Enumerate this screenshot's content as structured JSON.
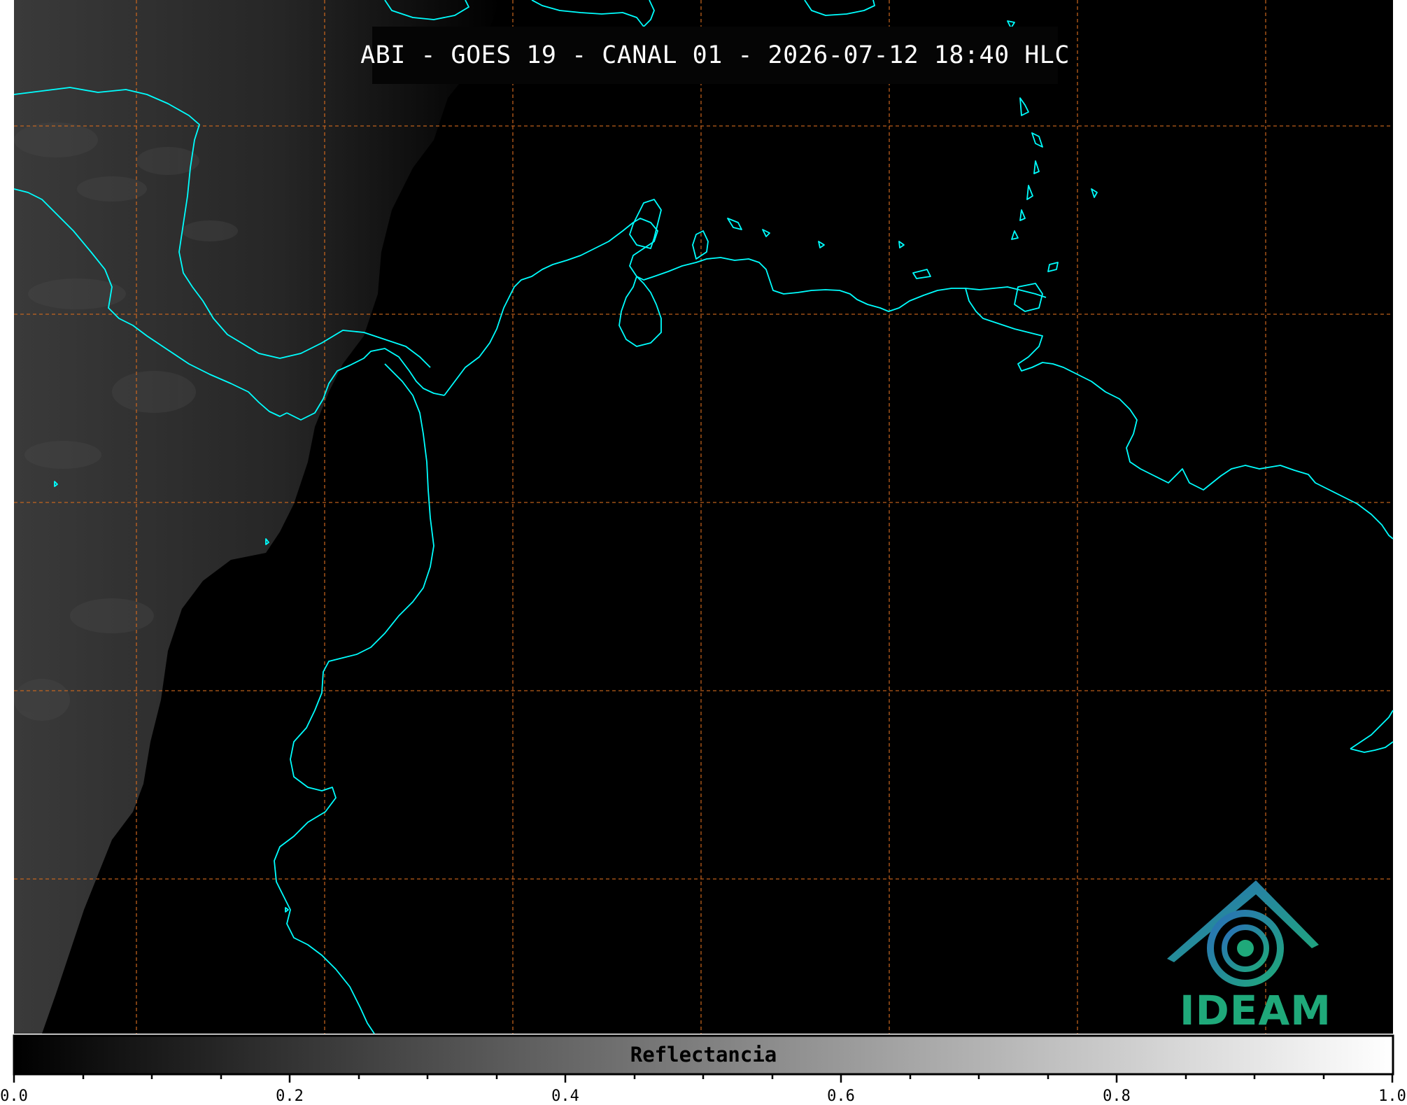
{
  "title": "ABI - GOES 19 - CANAL 01 - 2026-07-12 18:40 HLC",
  "colorbar": {
    "label": "Reflectancia",
    "ticks": [
      "0.0",
      "0.2",
      "0.4",
      "0.6",
      "0.8",
      "1.0"
    ],
    "range": [
      0.0,
      1.0
    ]
  },
  "logo": {
    "text": "IDEAM"
  },
  "colors": {
    "coastline": "#00ffff",
    "grid": "#d2691e",
    "background": "#000000",
    "logo_green": "#1fa97a",
    "logo_blue": "#2a7bb8"
  }
}
